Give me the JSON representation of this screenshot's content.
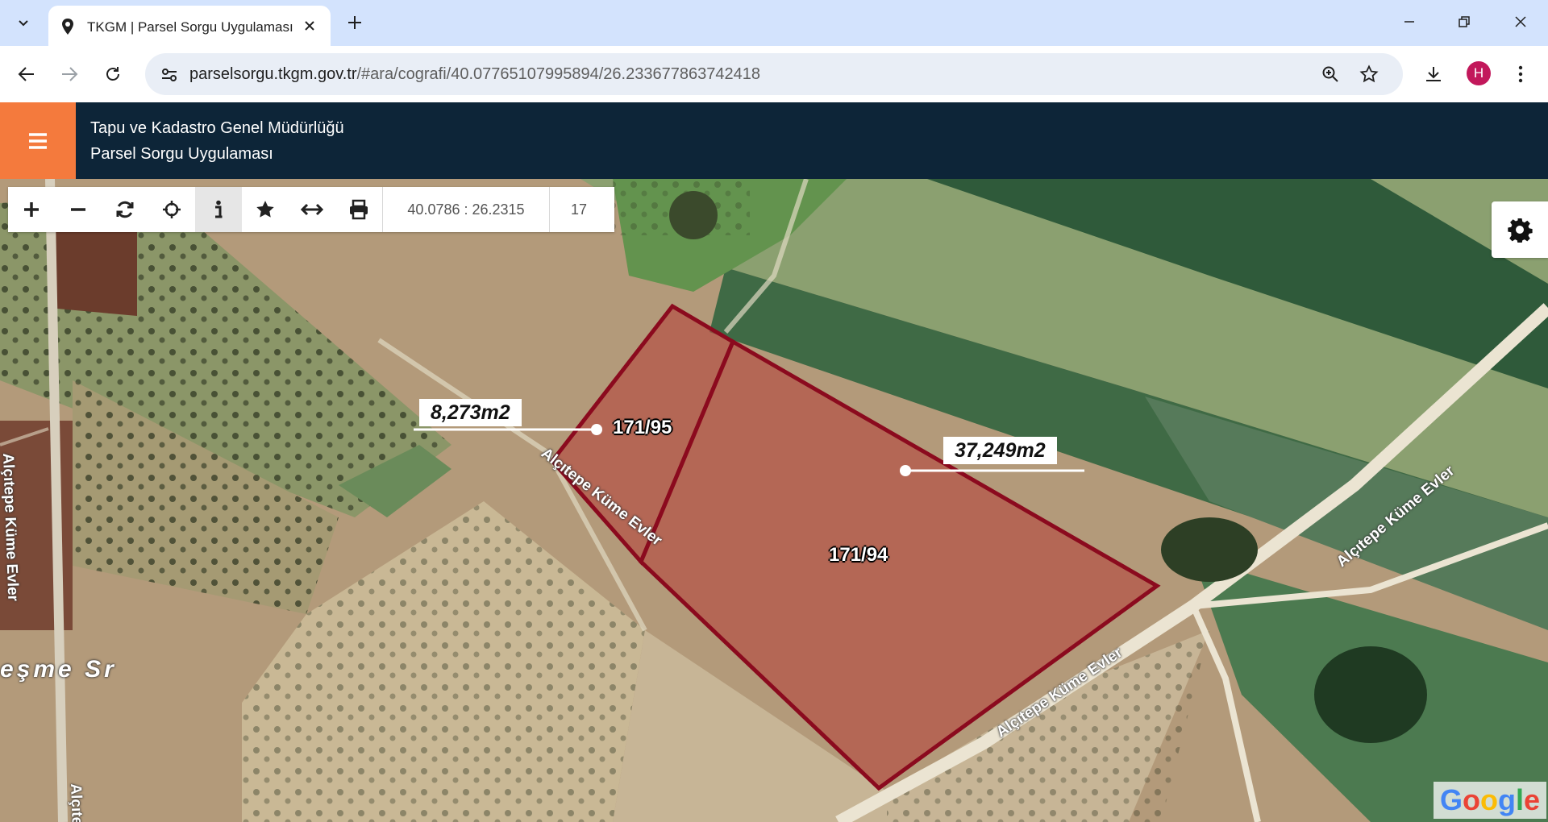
{
  "browser": {
    "tab_title": "TKGM | Parsel Sorgu Uygulaması",
    "url_host": "parselsorgu.tkgm.gov.tr",
    "url_path": "/#ara/cografi/40.07765107995894/26.233677863742418",
    "profile_initial": "H"
  },
  "header": {
    "line1": "Tapu ve Kadastro Genel Müdürlüğü",
    "line2": "Parsel Sorgu Uygulaması",
    "accent_color": "#f47a3d",
    "background_color": "#0d2538"
  },
  "map_toolbar": {
    "coordinates": "40.0786 : 26.2315",
    "zoom": "17",
    "tools": [
      "zoom-in-icon",
      "zoom-out-icon",
      "refresh-icon",
      "crosshair-icon",
      "info-icon",
      "star-icon",
      "measure-icon",
      "print-icon"
    ],
    "active_tool": "info-icon"
  },
  "parcels": [
    {
      "id": "171/95",
      "area": "8,273m2"
    },
    {
      "id": "171/94",
      "area": "37,249m2"
    }
  ],
  "roads": {
    "road_1": "Alçıtepe Küme Evler",
    "road_2": "Alçıtepe Küme Evler",
    "road_3": "Alçıtepe Küme Evler",
    "road_4": "Alçıtepe Küme Evler",
    "road_5": "Alçıtepe",
    "street_fragment": "eşme Sr"
  },
  "attribution": "Google",
  "parcel_stroke_color": "#8b0a1e"
}
